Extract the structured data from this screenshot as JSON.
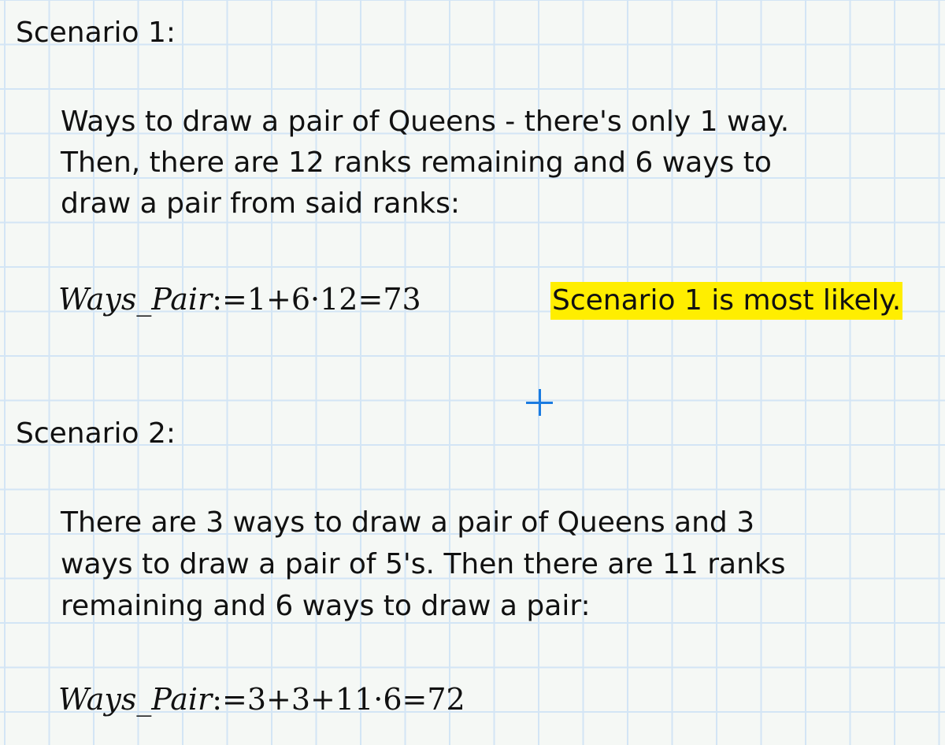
{
  "scenario1": {
    "heading": "Scenario 1:",
    "text": [
      "Ways to draw a pair of Queens - there's only 1 way.",
      "Then, there are 12 ranks remaining and 6 ways to",
      "draw a pair from said ranks:"
    ],
    "math_var": "Ways_Pair",
    "math_expr": ":=1+6·12=73",
    "highlight": "Scenario 1 is most likely."
  },
  "scenario2": {
    "heading": "Scenario 2:",
    "text": [
      "There are 3 ways to draw a pair of Queens and 3",
      "ways to draw a pair of 5's. Then there are 11 ranks",
      "remaining and 6 ways to draw a pair:"
    ],
    "math_var": "Ways_Pair",
    "math_expr": ":=3+3+11·6=72"
  },
  "colors": {
    "highlight": "#ffee00",
    "cursor": "#1a7be0",
    "grid": "#d3e5f5"
  }
}
